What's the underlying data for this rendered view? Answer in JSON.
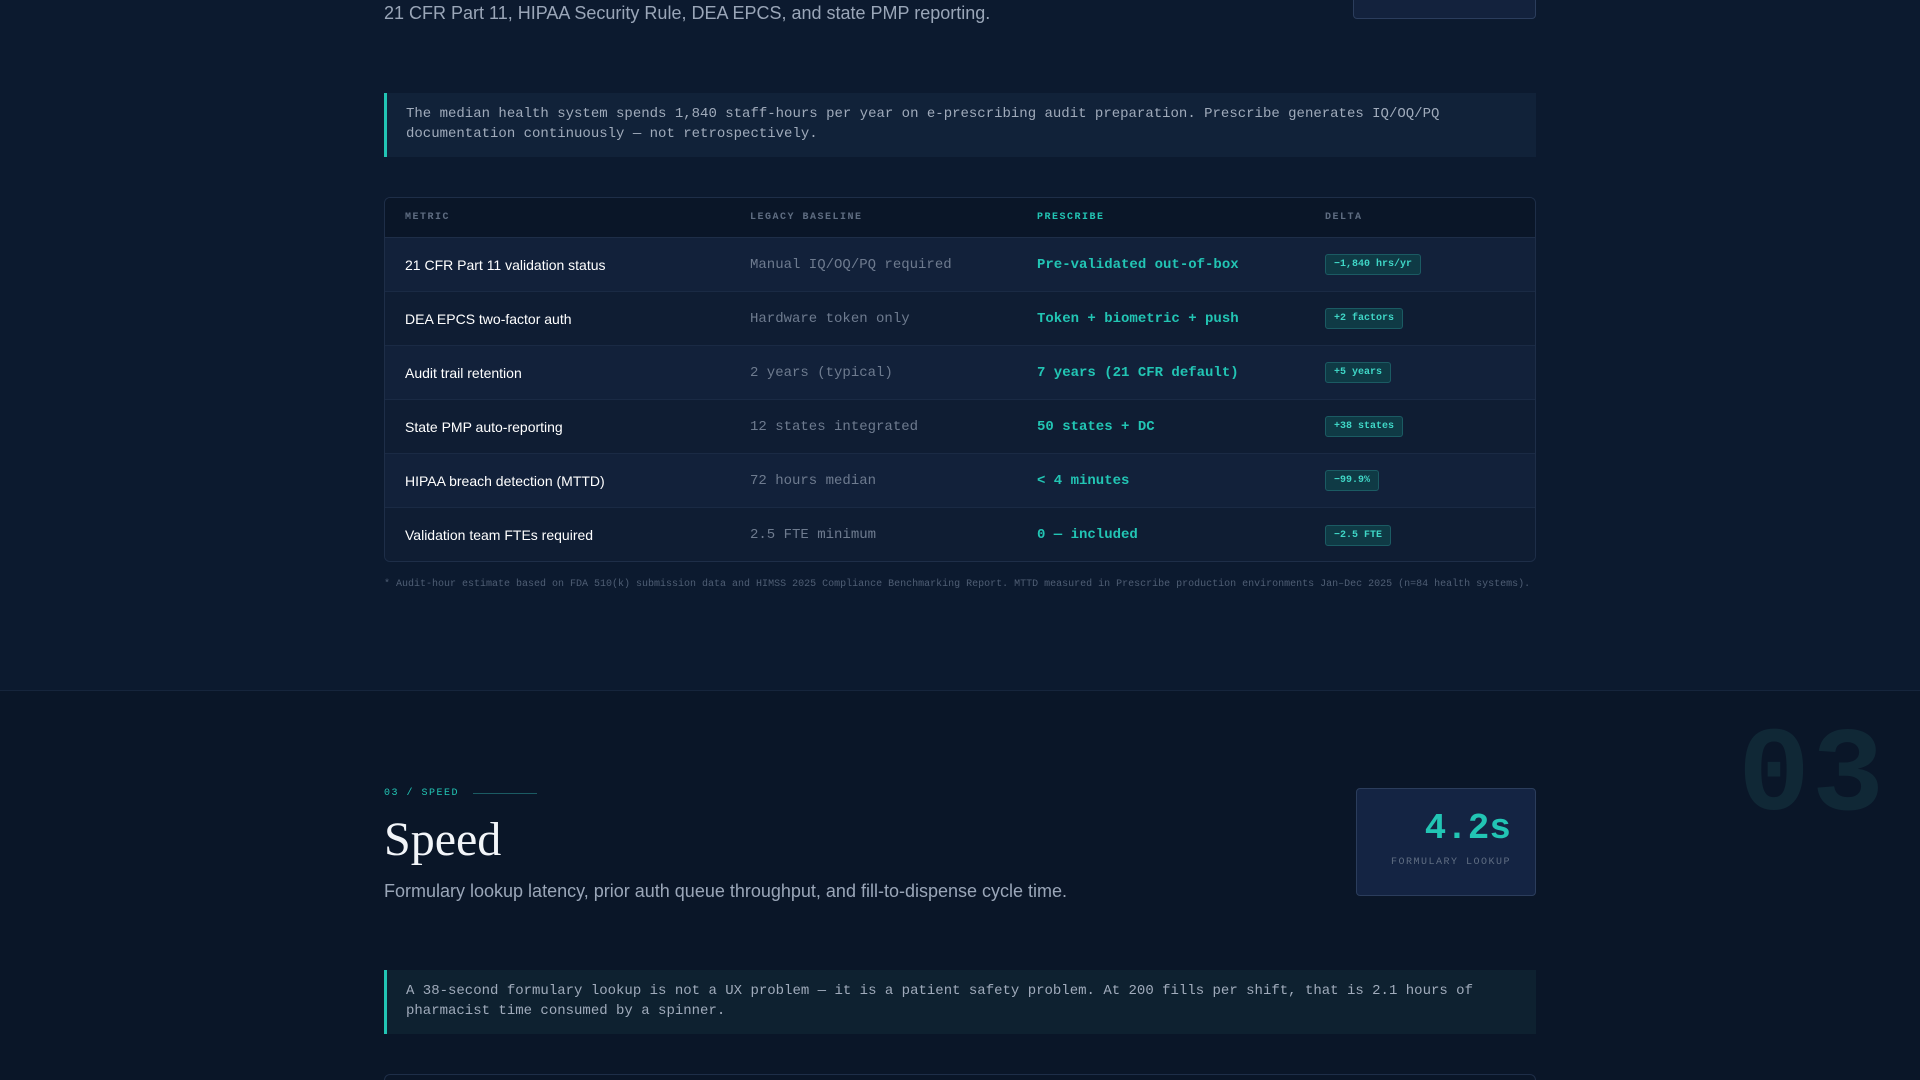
{
  "section1": {
    "subtitle": "21 CFR Part 11, HIPAA Security Rule, DEA EPCS, and state PMP reporting.",
    "callout": "The median health system spends 1,840 staff-hours per year on e-prescribing audit preparation. Prescribe generates IQ/OQ/PQ documentation continuously — not retrospectively.",
    "table": {
      "headers": [
        "METRIC",
        "LEGACY BASELINE",
        "PRESCRIBE",
        "DELTA"
      ],
      "rows": [
        {
          "metric": "21 CFR Part 11 validation status",
          "legacy": "Manual IQ/OQ/PQ required",
          "prescribe": "Pre-validated out-of-box",
          "delta": "−1,840 hrs/yr"
        },
        {
          "metric": "DEA EPCS two-factor auth",
          "legacy": "Hardware token only",
          "prescribe": "Token + biometric + push",
          "delta": "+2 factors"
        },
        {
          "metric": "Audit trail retention",
          "legacy": "2 years (typical)",
          "prescribe": "7 years (21 CFR default)",
          "delta": "+5 years"
        },
        {
          "metric": "State PMP auto-reporting",
          "legacy": "12 states integrated",
          "prescribe": "50 states + DC",
          "delta": "+38 states"
        },
        {
          "metric": "HIPAA breach detection (MTTD)",
          "legacy": "72 hours median",
          "prescribe": "< 4 minutes",
          "delta": "−99.9%"
        },
        {
          "metric": "Validation team FTEs required",
          "legacy": "2.5 FTE minimum",
          "prescribe": "0 — included",
          "delta": "−2.5 FTE"
        }
      ]
    },
    "footnote": "* Audit-hour estimate based on FDA 510(k) submission data and HIMSS 2025 Compliance Benchmarking Report. MTTD measured in Prescribe production environments Jan–Dec 2025 (n=84 health systems)."
  },
  "section2": {
    "number": "03",
    "eyebrow": "03 / SPEED",
    "title": "Speed",
    "subtitle": "Formulary lookup latency, prior auth queue throughput, and fill-to-dispense cycle time.",
    "stat": {
      "value": "4.2s",
      "label": "FORMULARY LOOKUP"
    },
    "callout": "A 38-second formulary lookup is not a UX problem — it is a patient safety problem. At 200 fills per shift, that is 2.1 hours of pharmacist time consumed by a spinner."
  },
  "colors": {
    "background": "#0c1a2f",
    "accent": "#22c5b4",
    "section2_background": "#0a1628"
  }
}
